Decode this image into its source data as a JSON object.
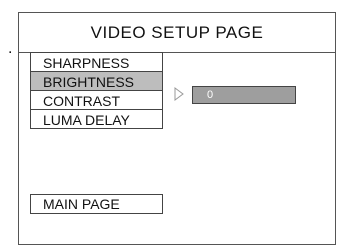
{
  "marker": ".",
  "title": "VIDEO SETUP PAGE",
  "menu": {
    "items": [
      {
        "label": "SHARPNESS"
      },
      {
        "label": "BRIGHTNESS",
        "selected": true
      },
      {
        "label": "CONTRAST"
      },
      {
        "label": "LUMA DELAY"
      }
    ]
  },
  "pointer_icon": "triangle-right",
  "value_box": {
    "value": "0"
  },
  "main_page": {
    "label": "MAIN PAGE"
  },
  "colors": {
    "selected_bg": "#bdbdbd",
    "value_bg": "#9e9e9e",
    "border": "#444444"
  }
}
